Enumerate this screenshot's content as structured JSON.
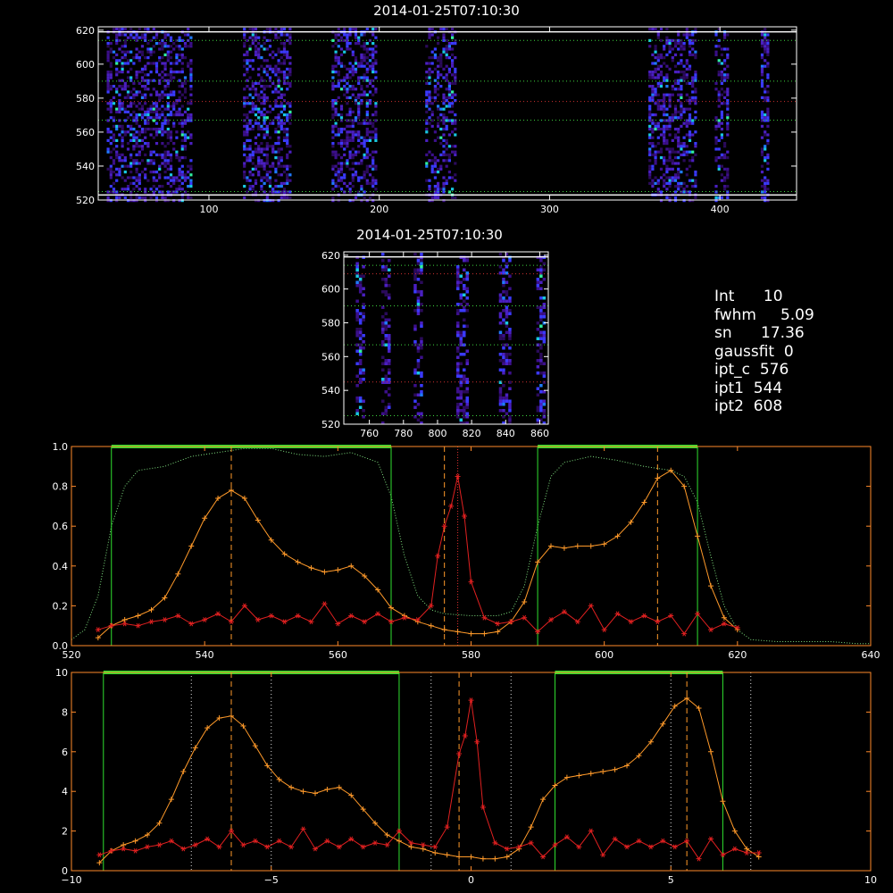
{
  "chart_data": [
    {
      "type": "heatmap",
      "title": "2014-01-25T07:10:30",
      "xlim": [
        35,
        445
      ],
      "ylim": [
        520,
        622
      ],
      "xticks": [
        "100",
        "200",
        "300",
        "400"
      ],
      "xtick_values": [
        100,
        200,
        300,
        400
      ],
      "yticks": [
        "520",
        "540",
        "560",
        "580",
        "600",
        "620"
      ],
      "ytick_values": [
        520,
        540,
        560,
        580,
        600,
        620
      ],
      "bright_columns": [
        [
          40,
          90
        ],
        [
          120,
          147
        ],
        [
          172,
          198
        ],
        [
          227,
          245
        ],
        [
          358,
          385
        ],
        [
          397,
          405
        ],
        [
          424,
          428
        ]
      ],
      "hlines_dotted": [
        614,
        590,
        567,
        525
      ],
      "hlines_solid": [
        619,
        523
      ],
      "hline_center": 578
    },
    {
      "type": "heatmap",
      "title": "2014-01-25T07:10:30",
      "xlim": [
        745,
        865
      ],
      "ylim": [
        520,
        622
      ],
      "xticks": [
        "760",
        "780",
        "800",
        "820",
        "840",
        "860"
      ],
      "xtick_values": [
        760,
        780,
        800,
        820,
        840,
        860
      ],
      "yticks": [
        "520",
        "540",
        "560",
        "580",
        "600",
        "620"
      ],
      "ytick_values": [
        520,
        540,
        560,
        580,
        600,
        620
      ],
      "bright_columns": [
        [
          752,
          757
        ],
        [
          767,
          772
        ],
        [
          786,
          790
        ],
        [
          811,
          817
        ],
        [
          836,
          843
        ],
        [
          858,
          862
        ]
      ],
      "hlines_dotted": [
        614,
        590,
        567,
        525
      ],
      "hlines_solid": [
        619
      ],
      "hline_red": [
        609,
        545
      ]
    },
    {
      "type": "line",
      "xlim": [
        520,
        640
      ],
      "ylim": [
        0,
        1.0
      ],
      "xticks": [
        "520",
        "540",
        "560",
        "580",
        "600",
        "620",
        "640"
      ],
      "xtick_values": [
        520,
        540,
        560,
        580,
        600,
        620,
        640
      ],
      "yticks": [
        "0.0",
        "0.2",
        "0.4",
        "0.6",
        "0.8",
        "1.0"
      ],
      "ytick_values": [
        0,
        0.2,
        0.4,
        0.6,
        0.8,
        1.0
      ],
      "green_windows": [
        [
          526,
          568
        ],
        [
          590,
          614
        ]
      ],
      "vlines_dashed": [
        544,
        576,
        608
      ],
      "vline_red_dotted": 578,
      "filter_curve": {
        "x": [
          520,
          522,
          524,
          526,
          528,
          530,
          534,
          538,
          542,
          546,
          550,
          554,
          558,
          562,
          566,
          568,
          570,
          572,
          574,
          576,
          580,
          584,
          586,
          588,
          590,
          592,
          594,
          598,
          602,
          606,
          610,
          612,
          614,
          616,
          618,
          620,
          622,
          626,
          630,
          634,
          638,
          640
        ],
        "y": [
          0.03,
          0.08,
          0.25,
          0.6,
          0.8,
          0.88,
          0.9,
          0.95,
          0.97,
          0.99,
          0.99,
          0.96,
          0.95,
          0.97,
          0.92,
          0.75,
          0.45,
          0.25,
          0.18,
          0.16,
          0.15,
          0.15,
          0.17,
          0.3,
          0.6,
          0.85,
          0.92,
          0.95,
          0.93,
          0.9,
          0.88,
          0.85,
          0.72,
          0.45,
          0.2,
          0.08,
          0.03,
          0.02,
          0.02,
          0.02,
          0.01,
          0.01
        ]
      },
      "orange_curve": {
        "x": [
          524,
          526,
          528,
          530,
          532,
          534,
          536,
          538,
          540,
          542,
          544,
          546,
          548,
          550,
          552,
          554,
          556,
          558,
          560,
          562,
          564,
          566,
          568,
          570,
          572,
          574,
          576,
          578,
          580,
          582,
          584,
          586,
          588,
          590,
          592,
          594,
          596,
          598,
          600,
          602,
          604,
          606,
          608,
          610,
          612,
          614,
          616,
          618,
          620
        ],
        "y": [
          0.04,
          0.1,
          0.13,
          0.15,
          0.18,
          0.24,
          0.36,
          0.5,
          0.64,
          0.74,
          0.78,
          0.74,
          0.63,
          0.53,
          0.46,
          0.42,
          0.39,
          0.37,
          0.38,
          0.4,
          0.35,
          0.28,
          0.19,
          0.15,
          0.12,
          0.1,
          0.08,
          0.07,
          0.06,
          0.06,
          0.07,
          0.12,
          0.22,
          0.42,
          0.5,
          0.49,
          0.5,
          0.5,
          0.51,
          0.55,
          0.62,
          0.72,
          0.84,
          0.88,
          0.8,
          0.55,
          0.3,
          0.14,
          0.08
        ]
      },
      "red_curve": {
        "x": [
          524,
          526,
          528,
          530,
          532,
          534,
          536,
          538,
          540,
          542,
          544,
          546,
          548,
          550,
          552,
          554,
          556,
          558,
          560,
          562,
          564,
          566,
          568,
          570,
          572,
          574,
          575,
          576,
          577,
          578,
          579,
          580,
          582,
          584,
          586,
          588,
          590,
          592,
          594,
          596,
          598,
          600,
          602,
          604,
          606,
          608,
          610,
          612,
          614,
          616,
          618,
          620
        ],
        "y": [
          0.08,
          0.1,
          0.11,
          0.1,
          0.12,
          0.13,
          0.15,
          0.11,
          0.13,
          0.16,
          0.12,
          0.2,
          0.13,
          0.15,
          0.12,
          0.15,
          0.12,
          0.21,
          0.11,
          0.15,
          0.12,
          0.16,
          0.12,
          0.14,
          0.13,
          0.2,
          0.45,
          0.6,
          0.7,
          0.85,
          0.65,
          0.32,
          0.14,
          0.11,
          0.12,
          0.14,
          0.07,
          0.13,
          0.17,
          0.12,
          0.2,
          0.08,
          0.16,
          0.12,
          0.15,
          0.12,
          0.15,
          0.06,
          0.16,
          0.08,
          0.11,
          0.09
        ]
      }
    },
    {
      "type": "line",
      "xlim": [
        -10,
        10
      ],
      "ylim": [
        0,
        10
      ],
      "xticks": [
        "−10",
        "−5",
        "0",
        "5",
        "10"
      ],
      "xtick_values": [
        -10,
        -5,
        0,
        5,
        10
      ],
      "yticks": [
        "0",
        "2",
        "4",
        "6",
        "8",
        "10"
      ],
      "ytick_values": [
        0,
        2,
        4,
        6,
        8,
        10
      ],
      "green_windows": [
        [
          -9.2,
          -1.8
        ],
        [
          2.1,
          6.3
        ]
      ],
      "vlines_dashed": [
        -6.0,
        -0.3,
        5.4
      ],
      "vlines_dotted": [
        -7.0,
        -5.0,
        -1.0,
        1.0,
        5.0,
        7.0
      ],
      "orange_curve": {
        "x": [
          -9.3,
          -9.0,
          -8.7,
          -8.4,
          -8.1,
          -7.8,
          -7.5,
          -7.2,
          -6.9,
          -6.6,
          -6.3,
          -6.0,
          -5.7,
          -5.4,
          -5.1,
          -4.8,
          -4.5,
          -4.2,
          -3.9,
          -3.6,
          -3.3,
          -3.0,
          -2.7,
          -2.4,
          -2.1,
          -1.8,
          -1.5,
          -1.2,
          -0.9,
          -0.6,
          -0.3,
          0.0,
          0.3,
          0.6,
          0.9,
          1.2,
          1.5,
          1.8,
          2.1,
          2.4,
          2.7,
          3.0,
          3.3,
          3.6,
          3.9,
          4.2,
          4.5,
          4.8,
          5.1,
          5.4,
          5.7,
          6.0,
          6.3,
          6.6,
          6.9,
          7.2
        ],
        "y": [
          0.4,
          1.0,
          1.3,
          1.5,
          1.8,
          2.4,
          3.6,
          5.0,
          6.2,
          7.2,
          7.7,
          7.8,
          7.3,
          6.3,
          5.3,
          4.6,
          4.2,
          4.0,
          3.9,
          4.1,
          4.2,
          3.8,
          3.1,
          2.4,
          1.8,
          1.5,
          1.2,
          1.1,
          0.9,
          0.8,
          0.7,
          0.7,
          0.6,
          0.6,
          0.7,
          1.1,
          2.2,
          3.6,
          4.3,
          4.7,
          4.8,
          4.9,
          5.0,
          5.1,
          5.3,
          5.8,
          6.5,
          7.4,
          8.3,
          8.7,
          8.2,
          6.0,
          3.5,
          2.0,
          1.1,
          0.7
        ]
      },
      "red_curve": {
        "x": [
          -9.3,
          -9.0,
          -8.7,
          -8.4,
          -8.1,
          -7.8,
          -7.5,
          -7.2,
          -6.9,
          -6.6,
          -6.3,
          -6.0,
          -5.7,
          -5.4,
          -5.1,
          -4.8,
          -4.5,
          -4.2,
          -3.9,
          -3.6,
          -3.3,
          -3.0,
          -2.7,
          -2.4,
          -2.1,
          -1.8,
          -1.5,
          -1.2,
          -0.9,
          -0.6,
          -0.3,
          -0.15,
          0.0,
          0.15,
          0.3,
          0.6,
          0.9,
          1.2,
          1.5,
          1.8,
          2.1,
          2.4,
          2.7,
          3.0,
          3.3,
          3.6,
          3.9,
          4.2,
          4.5,
          4.8,
          5.1,
          5.4,
          5.7,
          6.0,
          6.3,
          6.6,
          6.9,
          7.2
        ],
        "y": [
          0.8,
          1.0,
          1.1,
          1.0,
          1.2,
          1.3,
          1.5,
          1.1,
          1.3,
          1.6,
          1.2,
          2.0,
          1.3,
          1.5,
          1.2,
          1.5,
          1.2,
          2.1,
          1.1,
          1.5,
          1.2,
          1.6,
          1.2,
          1.4,
          1.3,
          2.0,
          1.4,
          1.3,
          1.2,
          2.2,
          5.9,
          6.8,
          8.6,
          6.5,
          3.2,
          1.4,
          1.1,
          1.2,
          1.4,
          0.7,
          1.3,
          1.7,
          1.2,
          2.0,
          0.8,
          1.6,
          1.2,
          1.5,
          1.2,
          1.5,
          1.2,
          1.5,
          0.6,
          1.6,
          0.8,
          1.1,
          0.9,
          0.9
        ]
      }
    }
  ],
  "stats": {
    "int_label": "Int      10",
    "fwhm_label": "fwhm     5.09",
    "sn_label": "sn      17.36",
    "gaussfit_label": "gaussfit  0",
    "ipt_c_label": "ipt_c  576",
    "ipt1_label": "ipt1  544",
    "ipt2_label": "ipt2  608"
  }
}
